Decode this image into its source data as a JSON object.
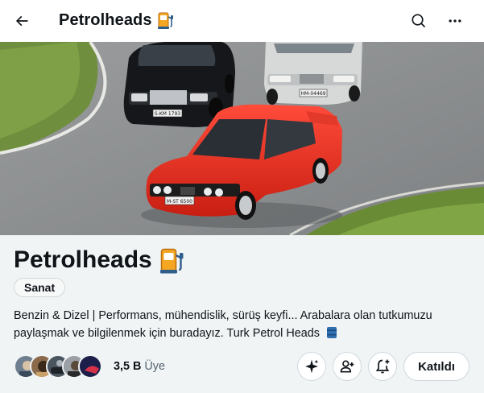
{
  "header": {
    "title": "Petrolheads",
    "back_icon": "arrow-left-icon",
    "search_icon": "search-icon",
    "more_icon": "more-horizontal-icon"
  },
  "banner": {
    "image_description_icon": "cars-banner-image",
    "plates": {
      "black_car": "S-KM 1793",
      "silver_car": "HM-04469",
      "red_car": "M-ST 6500"
    }
  },
  "community": {
    "name": "Petrolheads",
    "emoji_icon": "fuel-pump-icon",
    "category": "Sanat",
    "description_line1": "Benzin & Dizel | Performans, mühendislik, sürüş keyfi... Arabalara olan tutkumuzu",
    "description_line2": "paylaşmak ve bilgilenmek için buradayız. Turk Petrol Heads",
    "members_count": "3,5 B",
    "members_label": "Üye",
    "joined_label": "Katıldı"
  },
  "colors": {
    "text": "#0f1419",
    "muted": "#536471",
    "border": "#cfd9de",
    "background": "#f1f4f5"
  }
}
